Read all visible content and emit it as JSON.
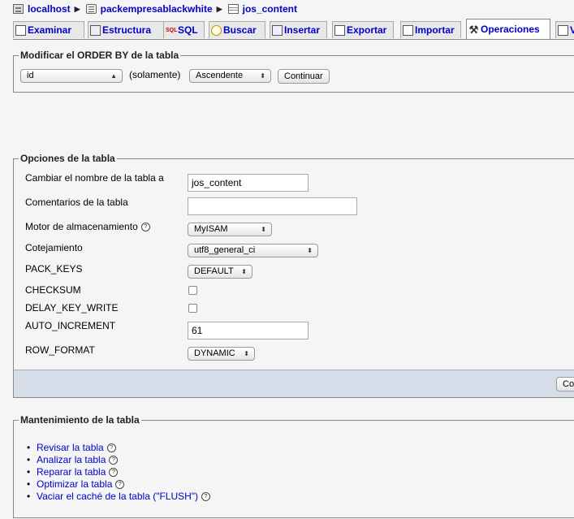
{
  "breadcrumb": [
    {
      "label": "localhost",
      "icon": "server-icon"
    },
    {
      "label": "packempresablackwhite",
      "icon": "database-icon"
    },
    {
      "label": "jos_content",
      "icon": "table-icon"
    }
  ],
  "tabs": [
    {
      "label": "Examinar",
      "icon": "browse-icon"
    },
    {
      "label": "Estructura",
      "icon": "structure-icon"
    },
    {
      "label": "SQL",
      "icon": "sql-icon"
    },
    {
      "label": "Buscar",
      "icon": "search-icon"
    },
    {
      "label": "Insertar",
      "icon": "insert-icon"
    },
    {
      "label": "Exportar",
      "icon": "export-icon"
    },
    {
      "label": "Importar",
      "icon": "import-icon"
    },
    {
      "label": "Operaciones",
      "icon": "operations-icon",
      "active": true
    },
    {
      "label": "V",
      "icon": "empty-icon"
    }
  ],
  "order_by": {
    "legend": "Modificar el ORDER BY de la tabla",
    "column_value": "id",
    "only_label": "(solamente)",
    "direction_value": "Ascendente",
    "continue_label": "Continuar"
  },
  "table_options": {
    "legend": "Opciones de la tabla",
    "rename_label": "Cambiar el nombre de la tabla a",
    "rename_value": "jos_content",
    "comments_label": "Comentarios de la tabla",
    "comments_value": "",
    "engine_label": "Motor de almacenamiento",
    "engine_value": "MyISAM",
    "collation_label": "Cotejamiento",
    "collation_value": "utf8_general_ci",
    "pack_keys_label": "PACK_KEYS",
    "pack_keys_value": "DEFAULT",
    "checksum_label": "CHECKSUM",
    "delay_key_write_label": "DELAY_KEY_WRITE",
    "auto_increment_label": "AUTO_INCREMENT",
    "auto_increment_value": "61",
    "row_format_label": "ROW_FORMAT",
    "row_format_value": "DYNAMIC",
    "continue_label_partial": "Cor"
  },
  "maintenance": {
    "legend": "Mantenimiento de la tabla",
    "items": [
      "Revisar la tabla",
      "Analizar la tabla",
      "Reparar la tabla",
      "Optimizar la tabla",
      "Vaciar el caché de la tabla (\"FLUSH\")"
    ]
  },
  "help_glyph": "?",
  "colors": {
    "link": "#0000cc",
    "background": "#f5f5f5",
    "footer_bar": "#d6dce8"
  }
}
